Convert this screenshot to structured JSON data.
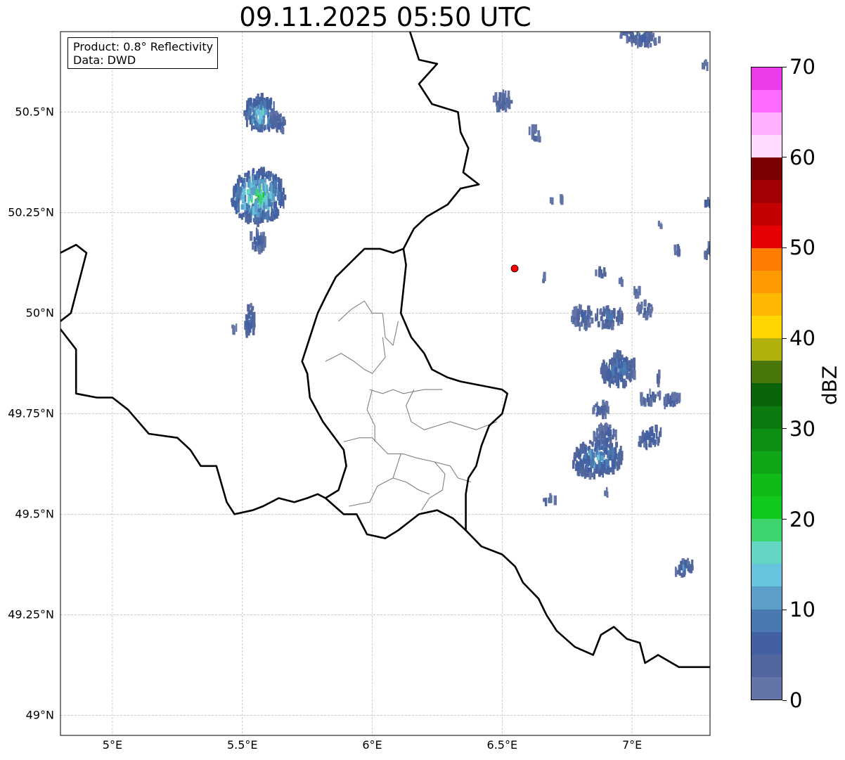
{
  "title": "09.11.2025 05:50 UTC",
  "info": {
    "product": "Product: 0.8° Reflectivity",
    "data_source": "Data: DWD"
  },
  "map": {
    "lon_range": [
      4.8,
      7.3
    ],
    "lat_range": [
      48.95,
      50.7
    ],
    "lon_ticks": [
      {
        "value": 5.0,
        "label": "5°E"
      },
      {
        "value": 5.5,
        "label": "5.5°E"
      },
      {
        "value": 6.0,
        "label": "6°E"
      },
      {
        "value": 6.5,
        "label": "6.5°E"
      },
      {
        "value": 7.0,
        "label": "7°E"
      }
    ],
    "lat_ticks": [
      {
        "value": 49.0,
        "label": "49°N"
      },
      {
        "value": 49.25,
        "label": "49.25°N"
      },
      {
        "value": 49.5,
        "label": "49.5°N"
      },
      {
        "value": 49.75,
        "label": "49.75°N"
      },
      {
        "value": 50.0,
        "label": "50°N"
      },
      {
        "value": 50.25,
        "label": "50.25°N"
      },
      {
        "value": 50.5,
        "label": "50.5°N"
      }
    ],
    "radar_site": {
      "lon": 6.548,
      "lat": 50.111,
      "color": "#ff0000"
    },
    "country_borders": [
      [
        [
          6.14,
          50.71
        ],
        [
          6.18,
          50.63
        ],
        [
          6.25,
          50.62
        ],
        [
          6.18,
          50.57
        ],
        [
          6.23,
          50.52
        ],
        [
          6.33,
          50.5
        ],
        [
          6.34,
          50.45
        ],
        [
          6.37,
          50.41
        ],
        [
          6.35,
          50.35
        ],
        [
          6.41,
          50.32
        ],
        [
          6.34,
          50.31
        ],
        [
          6.29,
          50.27
        ],
        [
          6.21,
          50.24
        ],
        [
          6.16,
          50.21
        ],
        [
          6.12,
          50.16
        ],
        [
          6.13,
          50.12
        ],
        [
          6.12,
          50.06
        ],
        [
          6.11,
          50.0
        ],
        [
          6.15,
          49.94
        ],
        [
          6.2,
          49.9
        ],
        [
          6.23,
          49.86
        ],
        [
          6.29,
          49.84
        ],
        [
          6.34,
          49.83
        ],
        [
          6.42,
          49.82
        ],
        [
          6.5,
          49.81
        ],
        [
          6.52,
          49.8
        ],
        [
          6.5,
          49.75
        ],
        [
          6.45,
          49.72
        ],
        [
          6.42,
          49.67
        ],
        [
          6.4,
          49.62
        ],
        [
          6.37,
          49.59
        ],
        [
          6.36,
          49.55
        ],
        [
          6.36,
          49.46
        ]
      ],
      [
        [
          6.36,
          49.46
        ],
        [
          6.42,
          49.42
        ],
        [
          6.5,
          49.4
        ],
        [
          6.55,
          49.37
        ],
        [
          6.58,
          49.33
        ],
        [
          6.64,
          49.29
        ],
        [
          6.67,
          49.25
        ],
        [
          6.71,
          49.21
        ],
        [
          6.78,
          49.17
        ],
        [
          6.85,
          49.15
        ],
        [
          6.88,
          49.2
        ],
        [
          6.93,
          49.22
        ],
        [
          6.98,
          49.19
        ],
        [
          7.03,
          49.18
        ],
        [
          7.05,
          49.13
        ],
        [
          7.1,
          49.15
        ],
        [
          7.18,
          49.12
        ],
        [
          7.24,
          49.12
        ],
        [
          7.3,
          49.12
        ]
      ],
      [
        [
          6.36,
          49.46
        ],
        [
          6.31,
          49.49
        ],
        [
          6.25,
          49.51
        ],
        [
          6.18,
          49.5
        ],
        [
          6.1,
          49.46
        ],
        [
          6.05,
          49.44
        ],
        [
          5.98,
          49.45
        ],
        [
          5.94,
          49.5
        ],
        [
          5.89,
          49.5
        ],
        [
          5.82,
          49.54
        ],
        [
          5.79,
          49.55
        ],
        [
          5.75,
          49.54
        ],
        [
          5.7,
          49.53
        ],
        [
          5.64,
          49.54
        ],
        [
          5.58,
          49.52
        ],
        [
          5.54,
          49.51
        ],
        [
          5.47,
          49.5
        ],
        [
          5.44,
          49.53
        ],
        [
          5.4,
          49.62
        ],
        [
          5.34,
          49.62
        ],
        [
          5.3,
          49.66
        ],
        [
          5.25,
          49.69
        ],
        [
          5.14,
          49.7
        ],
        [
          5.06,
          49.76
        ],
        [
          5.0,
          49.79
        ],
        [
          4.94,
          49.79
        ],
        [
          4.86,
          49.8
        ],
        [
          4.86,
          49.91
        ],
        [
          4.8,
          49.96
        ]
      ],
      [
        [
          5.82,
          49.54
        ],
        [
          5.87,
          49.56
        ],
        [
          5.9,
          49.62
        ],
        [
          5.89,
          49.66
        ],
        [
          5.81,
          49.73
        ],
        [
          5.76,
          49.79
        ],
        [
          5.75,
          49.85
        ],
        [
          5.73,
          49.88
        ],
        [
          5.75,
          49.92
        ],
        [
          5.77,
          49.96
        ],
        [
          5.79,
          50.0
        ],
        [
          5.82,
          50.04
        ],
        [
          5.86,
          50.09
        ],
        [
          5.97,
          50.16
        ],
        [
          6.03,
          50.16
        ],
        [
          6.08,
          50.15
        ],
        [
          6.12,
          50.16
        ]
      ],
      [
        [
          4.8,
          50.15
        ],
        [
          4.86,
          50.17
        ],
        [
          4.9,
          50.15
        ],
        [
          4.88,
          50.1
        ],
        [
          4.86,
          50.05
        ],
        [
          4.84,
          50.0
        ],
        [
          4.8,
          49.98
        ]
      ]
    ],
    "province_borders": [
      [
        [
          5.82,
          49.88
        ],
        [
          5.88,
          49.9
        ],
        [
          5.93,
          49.88
        ],
        [
          5.97,
          49.86
        ],
        [
          6.0,
          49.85
        ]
      ],
      [
        [
          5.87,
          49.98
        ],
        [
          5.92,
          50.01
        ],
        [
          5.97,
          50.03
        ],
        [
          6.0,
          50.0
        ],
        [
          6.04,
          50.0
        ]
      ],
      [
        [
          6.04,
          50.0
        ],
        [
          6.05,
          49.94
        ],
        [
          6.08,
          49.92
        ],
        [
          6.1,
          49.98
        ]
      ],
      [
        [
          6.0,
          49.85
        ],
        [
          6.05,
          49.89
        ],
        [
          6.04,
          49.94
        ]
      ],
      [
        [
          5.99,
          49.81
        ],
        [
          6.04,
          49.8
        ],
        [
          6.08,
          49.81
        ],
        [
          6.12,
          49.8
        ],
        [
          6.2,
          49.81
        ],
        [
          6.27,
          49.81
        ]
      ],
      [
        [
          6.0,
          49.81
        ],
        [
          5.98,
          49.76
        ],
        [
          6.01,
          49.72
        ],
        [
          6.01,
          49.68
        ]
      ],
      [
        [
          6.16,
          49.81
        ],
        [
          6.13,
          49.77
        ],
        [
          6.15,
          49.73
        ],
        [
          6.2,
          49.71
        ],
        [
          6.25,
          49.72
        ],
        [
          6.3,
          49.73
        ],
        [
          6.4,
          49.71
        ],
        [
          6.48,
          49.73
        ]
      ],
      [
        [
          5.89,
          49.68
        ],
        [
          5.95,
          49.69
        ],
        [
          6.0,
          49.69
        ],
        [
          6.06,
          49.65
        ],
        [
          6.12,
          49.65
        ],
        [
          6.17,
          49.64
        ],
        [
          6.24,
          49.63
        ],
        [
          6.3,
          49.62
        ],
        [
          6.33,
          49.59
        ],
        [
          6.38,
          49.58
        ]
      ],
      [
        [
          6.11,
          49.65
        ],
        [
          6.08,
          49.59
        ],
        [
          6.02,
          49.57
        ],
        [
          5.99,
          49.53
        ],
        [
          5.91,
          49.52
        ]
      ],
      [
        [
          6.24,
          49.63
        ],
        [
          6.28,
          49.6
        ],
        [
          6.27,
          49.56
        ],
        [
          6.22,
          49.54
        ],
        [
          6.19,
          49.51
        ]
      ],
      [
        [
          6.08,
          49.59
        ],
        [
          6.13,
          49.58
        ],
        [
          6.18,
          49.56
        ],
        [
          6.22,
          49.55
        ]
      ]
    ]
  },
  "radar_echoes": [
    {
      "lon": 5.57,
      "lat": 50.495,
      "w": 0.13,
      "h": 0.09,
      "angle": -35,
      "peak_dbz": 20
    },
    {
      "lon": 5.64,
      "lat": 50.475,
      "w": 0.05,
      "h": 0.05,
      "angle": -35,
      "peak_dbz": 10
    },
    {
      "lon": 5.56,
      "lat": 50.29,
      "w": 0.21,
      "h": 0.13,
      "angle": -15,
      "peak_dbz": 24
    },
    {
      "lon": 5.56,
      "lat": 50.18,
      "w": 0.06,
      "h": 0.05,
      "angle": 0,
      "peak_dbz": 10
    },
    {
      "lon": 5.53,
      "lat": 49.98,
      "w": 0.04,
      "h": 0.08,
      "angle": 0,
      "peak_dbz": 12
    },
    {
      "lon": 5.47,
      "lat": 49.965,
      "w": 0.015,
      "h": 0.02,
      "angle": 0,
      "peak_dbz": 5
    },
    {
      "lon": 7.03,
      "lat": 50.685,
      "w": 0.16,
      "h": 0.035,
      "angle": 10,
      "peak_dbz": 8
    },
    {
      "lon": 6.5,
      "lat": 50.525,
      "w": 0.09,
      "h": 0.04,
      "angle": -20,
      "peak_dbz": 8
    },
    {
      "lon": 6.625,
      "lat": 50.445,
      "w": 0.04,
      "h": 0.04,
      "angle": -20,
      "peak_dbz": 5
    },
    {
      "lon": 7.28,
      "lat": 50.615,
      "w": 0.02,
      "h": 0.02,
      "angle": 0,
      "peak_dbz": 5
    },
    {
      "lon": 7.29,
      "lat": 50.27,
      "w": 0.02,
      "h": 0.02,
      "angle": 0,
      "peak_dbz": 15
    },
    {
      "lon": 7.29,
      "lat": 50.16,
      "w": 0.03,
      "h": 0.04,
      "angle": 0,
      "peak_dbz": 8
    },
    {
      "lon": 7.175,
      "lat": 50.16,
      "w": 0.03,
      "h": 0.03,
      "angle": 0,
      "peak_dbz": 5
    },
    {
      "lon": 7.11,
      "lat": 50.22,
      "w": 0.02,
      "h": 0.015,
      "angle": 0,
      "peak_dbz": 5
    },
    {
      "lon": 6.88,
      "lat": 50.1,
      "w": 0.04,
      "h": 0.02,
      "angle": 0,
      "peak_dbz": 8
    },
    {
      "lon": 6.81,
      "lat": 49.99,
      "w": 0.09,
      "h": 0.05,
      "angle": 0,
      "peak_dbz": 8
    },
    {
      "lon": 6.91,
      "lat": 49.99,
      "w": 0.11,
      "h": 0.05,
      "angle": 0,
      "peak_dbz": 10
    },
    {
      "lon": 7.05,
      "lat": 50.01,
      "w": 0.06,
      "h": 0.035,
      "angle": 0,
      "peak_dbz": 8
    },
    {
      "lon": 6.95,
      "lat": 49.86,
      "w": 0.14,
      "h": 0.08,
      "angle": -25,
      "peak_dbz": 14
    },
    {
      "lon": 7.02,
      "lat": 50.05,
      "w": 0.03,
      "h": 0.02,
      "angle": 0,
      "peak_dbz": 5
    },
    {
      "lon": 7.1,
      "lat": 49.84,
      "w": 0.015,
      "h": 0.03,
      "angle": 0,
      "peak_dbz": 5
    },
    {
      "lon": 7.07,
      "lat": 49.79,
      "w": 0.08,
      "h": 0.03,
      "angle": -20,
      "peak_dbz": 8
    },
    {
      "lon": 7.15,
      "lat": 49.78,
      "w": 0.08,
      "h": 0.03,
      "angle": -20,
      "peak_dbz": 8
    },
    {
      "lon": 6.88,
      "lat": 49.76,
      "w": 0.06,
      "h": 0.04,
      "angle": 0,
      "peak_dbz": 8
    },
    {
      "lon": 6.9,
      "lat": 49.7,
      "w": 0.1,
      "h": 0.04,
      "angle": -15,
      "peak_dbz": 8
    },
    {
      "lon": 6.87,
      "lat": 49.64,
      "w": 0.2,
      "h": 0.09,
      "angle": -15,
      "peak_dbz": 16
    },
    {
      "lon": 7.07,
      "lat": 49.69,
      "w": 0.1,
      "h": 0.04,
      "angle": -35,
      "peak_dbz": 12
    },
    {
      "lon": 6.9,
      "lat": 49.55,
      "w": 0.015,
      "h": 0.015,
      "angle": 0,
      "peak_dbz": 5
    },
    {
      "lon": 6.68,
      "lat": 49.535,
      "w": 0.05,
      "h": 0.015,
      "angle": 0,
      "peak_dbz": 8
    },
    {
      "lon": 7.2,
      "lat": 49.365,
      "w": 0.08,
      "h": 0.03,
      "angle": -25,
      "peak_dbz": 12
    },
    {
      "lon": 6.69,
      "lat": 50.28,
      "w": 0.01,
      "h": 0.01,
      "angle": 0,
      "peak_dbz": 5
    },
    {
      "lon": 6.73,
      "lat": 50.285,
      "w": 0.01,
      "h": 0.01,
      "angle": 0,
      "peak_dbz": 5
    },
    {
      "lon": 6.96,
      "lat": 50.08,
      "w": 0.015,
      "h": 0.015,
      "angle": 0,
      "peak_dbz": 5
    },
    {
      "lon": 6.66,
      "lat": 50.09,
      "w": 0.01,
      "h": 0.02,
      "angle": 0,
      "peak_dbz": 5
    }
  ],
  "colorbar": {
    "label": "dBZ",
    "ticks": [
      {
        "value": 0,
        "label": "0"
      },
      {
        "value": 10,
        "label": "10"
      },
      {
        "value": 20,
        "label": "20"
      },
      {
        "value": 30,
        "label": "30"
      },
      {
        "value": 40,
        "label": "40"
      },
      {
        "value": 50,
        "label": "50"
      },
      {
        "value": 60,
        "label": "60"
      },
      {
        "value": 70,
        "label": "70"
      }
    ],
    "range": [
      0,
      70
    ],
    "colors": [
      "#6375a7",
      "#52669e",
      "#4360a2",
      "#4a78b0",
      "#5b9ec8",
      "#68c4dd",
      "#62d5c3",
      "#3dd46d",
      "#11c91c",
      "#10ba17",
      "#10a617",
      "#0c8f12",
      "#0b7a0f",
      "#0a640b",
      "#4a7709",
      "#b0b10c",
      "#ffd601",
      "#ffb802",
      "#ff9a02",
      "#ff7b02",
      "#e60004",
      "#c40003",
      "#a10002",
      "#7b0001",
      "#ffdbff",
      "#ffb0ff",
      "#fd6bff",
      "#ea3aea"
    ]
  }
}
